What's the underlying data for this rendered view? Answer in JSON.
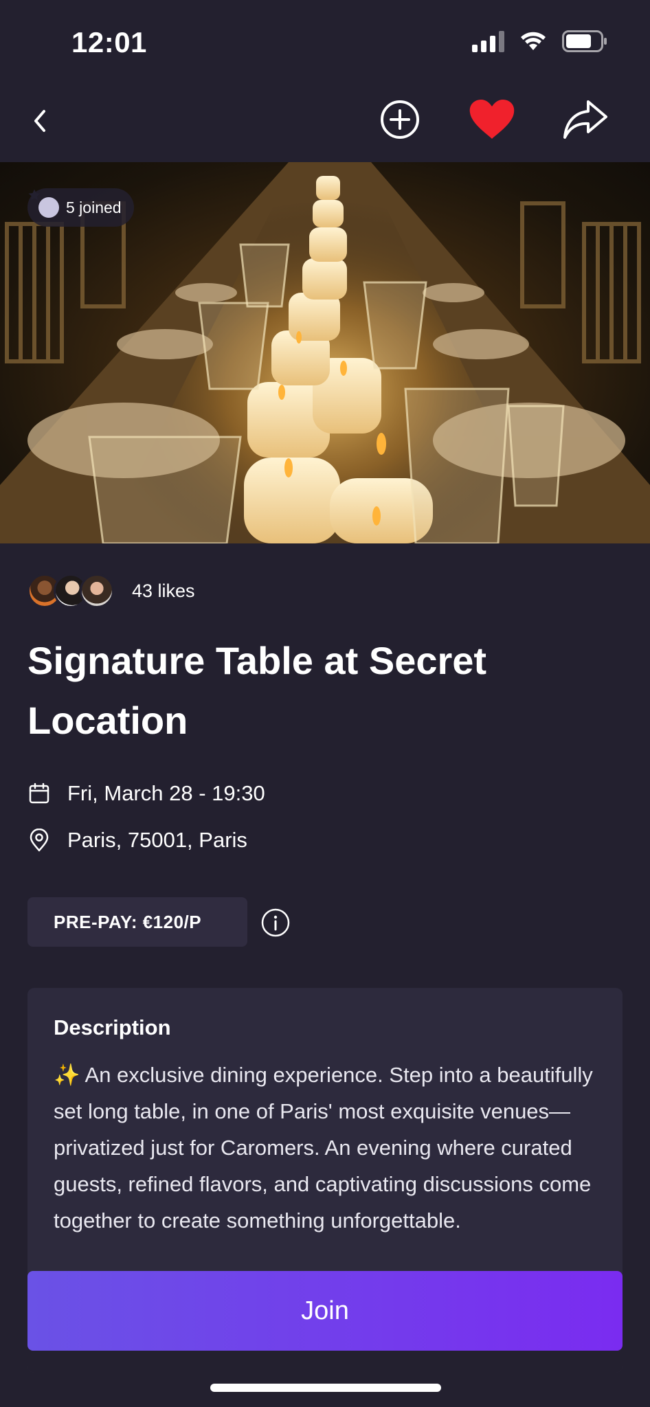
{
  "status_bar": {
    "time": "12:01"
  },
  "event": {
    "joined_badge": "5 joined",
    "likes": "43 likes",
    "title": "Signature Table at Secret Location",
    "date": "Fri, March 28 - 19:30",
    "location": "Paris, 75001, Paris",
    "prepay": "PRE-PAY: €120/P"
  },
  "description": {
    "heading": "Description",
    "emoji": "✨",
    "text": "An exclusive dining experience. Step into a beautifully set long table, in one of Paris' most exquisite venues—privatized just for Caromers. An evening where curated guests, refined flavors, and captivating discussions come together to create something unforgettable."
  },
  "actions": {
    "join_label": "Join"
  },
  "icons": {
    "back": "chevron-left-icon",
    "add": "plus-circle-icon",
    "favorite": "heart-icon",
    "share": "share-icon",
    "calendar": "calendar-icon",
    "location": "location-pin-icon",
    "info": "info-icon"
  },
  "colors": {
    "background": "#23202f",
    "card": "#2d2a3d",
    "heart": "#f0212c",
    "join_gradient_start": "#6a52e6",
    "join_gradient_end": "#7a2cf0"
  }
}
